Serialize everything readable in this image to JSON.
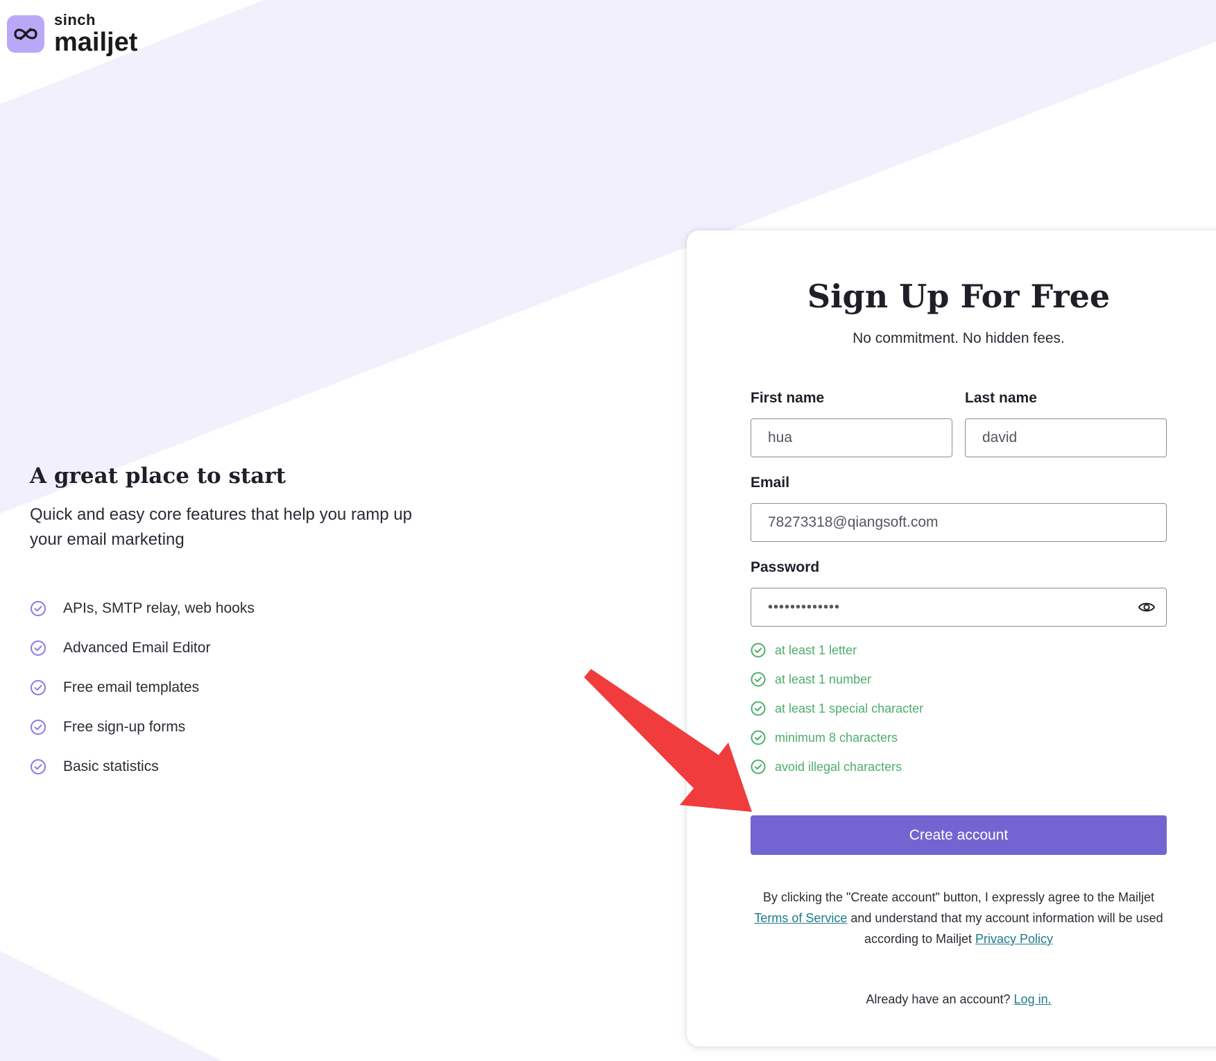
{
  "brand": {
    "sinch": "sinch",
    "mailjet": "mailjet",
    "badge_color": "#b9a8f7",
    "icon": "infinity-logo-icon"
  },
  "promo": {
    "title": "A great place to start",
    "subtitle": "Quick and easy core features that help you ramp up your email marketing",
    "features": [
      "APIs, SMTP relay, web hooks",
      "Advanced Email Editor",
      "Free email templates",
      "Free sign-up forms",
      "Basic statistics"
    ],
    "check_icon": "check-circle-icon",
    "check_color": "#8a78e6"
  },
  "form": {
    "title": "Sign Up For Free",
    "subtitle": "No commitment. No hidden fees.",
    "first_name": {
      "label": "First name",
      "value": "hua"
    },
    "last_name": {
      "label": "Last name",
      "value": "david"
    },
    "email": {
      "label": "Email",
      "value": "78273318@qiangsoft.com"
    },
    "password": {
      "label": "Password",
      "value": "•••••••••••••",
      "toggle_icon": "eye-icon"
    },
    "rules": [
      "at least 1 letter",
      "at least 1 number",
      "at least 1 special character",
      "minimum 8 characters",
      "avoid illegal characters"
    ],
    "rule_color": "#4dae6b",
    "submit_label": "Create account",
    "submit_color": "#7265d1",
    "legal": {
      "before_tos": "By clicking the \"Create account\" button, I expressly agree to the Mailjet ",
      "tos_link": "Terms of Service",
      "middle": " and understand that my account information will be used according to Mailjet ",
      "privacy_link": "Privacy Policy"
    },
    "login": {
      "prompt": "Already have an account? ",
      "link": "Log in."
    }
  },
  "annotation": {
    "arrow_color": "#f03c3c"
  }
}
